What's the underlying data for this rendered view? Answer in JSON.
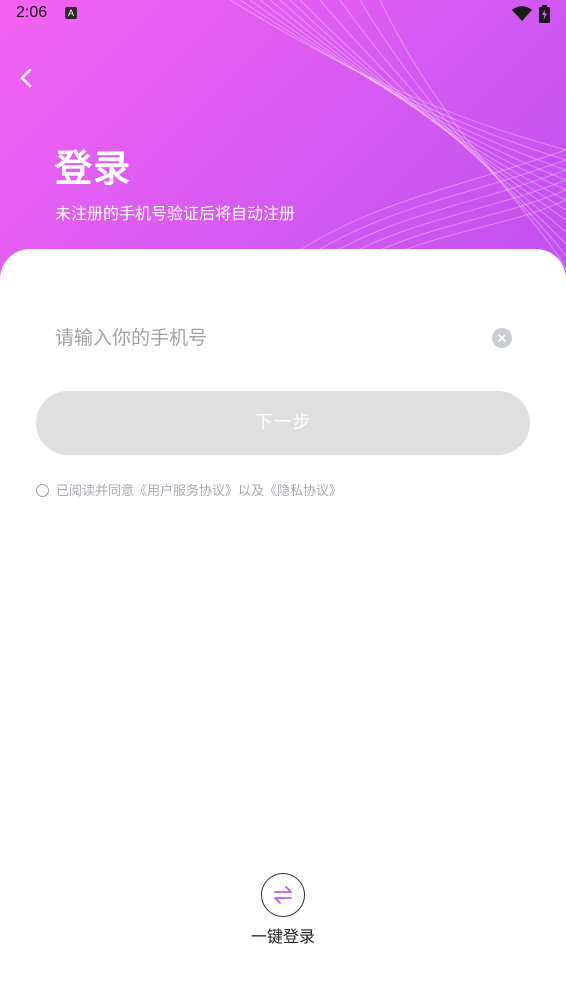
{
  "status_bar": {
    "time": "2:06",
    "notification_icon": "A"
  },
  "header": {
    "title": "登录",
    "subtitle": "未注册的手机号验证后将自动注册",
    "back_icon": "chevron-left-icon"
  },
  "form": {
    "phone_placeholder": "请输入你的手机号",
    "phone_value": "",
    "clear_icon": "close-circle-icon",
    "next_label": "下一步"
  },
  "agreement": {
    "prefix": "已阅读并同意",
    "user_agreement": "《用户服务协议》",
    "connector": "以及",
    "privacy_policy": "《隐私协议》",
    "checked": false
  },
  "one_key_login": {
    "label": "一键登录",
    "icon": "swap-arrows-icon"
  },
  "colors": {
    "header_gradient_start": "#f562f4",
    "header_gradient_end": "#c04ef0",
    "button_disabled": "#dfdfdf",
    "accent_icon": "#c65af0"
  }
}
